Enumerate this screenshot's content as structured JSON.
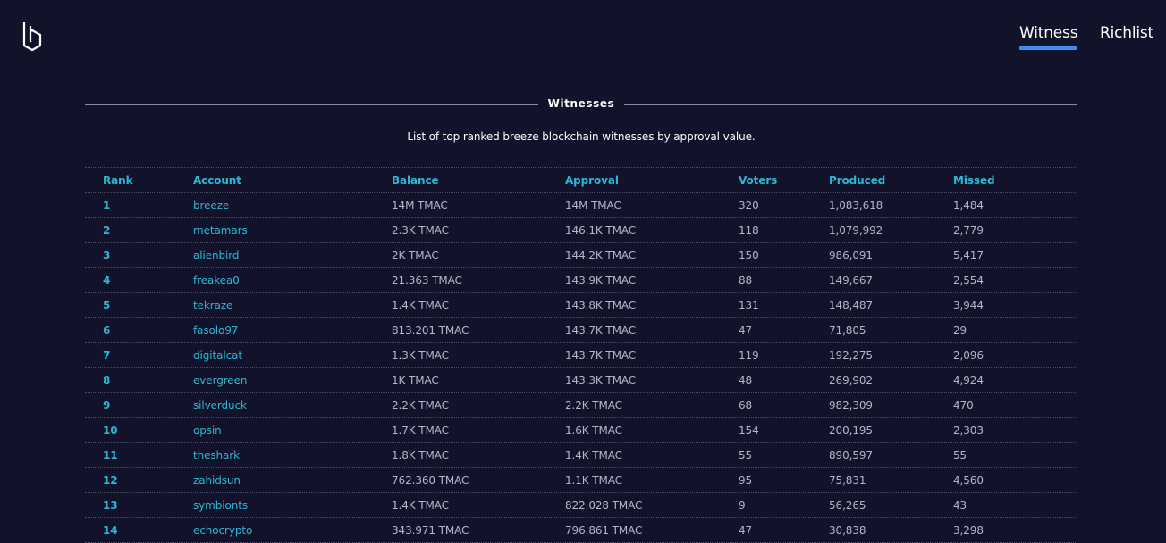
{
  "nav": {
    "tabs": [
      {
        "label": "Witness",
        "active": true
      },
      {
        "label": "Richlist",
        "active": false
      }
    ]
  },
  "brand": {
    "logo_icon": "breeze-logo-icon",
    "accent": "#3d8cf0",
    "link_color": "#2bb6d2"
  },
  "section": {
    "title": "Witnesses",
    "subtitle": "List of top ranked breeze blockchain witnesses by approval value."
  },
  "table": {
    "headers": {
      "rank": "Rank",
      "account": "Account",
      "balance": "Balance",
      "approval": "Approval",
      "voters": "Voters",
      "produced": "Produced",
      "missed": "Missed"
    },
    "rows": [
      {
        "rank": "1",
        "account": "breeze",
        "balance": "14M TMAC",
        "approval": "14M TMAC",
        "voters": "320",
        "produced": "1,083,618",
        "missed": "1,484"
      },
      {
        "rank": "2",
        "account": "metamars",
        "balance": "2.3K TMAC",
        "approval": "146.1K TMAC",
        "voters": "118",
        "produced": "1,079,992",
        "missed": "2,779"
      },
      {
        "rank": "3",
        "account": "alienbird",
        "balance": "2K TMAC",
        "approval": "144.2K TMAC",
        "voters": "150",
        "produced": "986,091",
        "missed": "5,417"
      },
      {
        "rank": "4",
        "account": "freakea0",
        "balance": "21.363 TMAC",
        "approval": "143.9K TMAC",
        "voters": "88",
        "produced": "149,667",
        "missed": "2,554"
      },
      {
        "rank": "5",
        "account": "tekraze",
        "balance": "1.4K TMAC",
        "approval": "143.8K TMAC",
        "voters": "131",
        "produced": "148,487",
        "missed": "3,944"
      },
      {
        "rank": "6",
        "account": "fasolo97",
        "balance": "813.201 TMAC",
        "approval": "143.7K TMAC",
        "voters": "47",
        "produced": "71,805",
        "missed": "29"
      },
      {
        "rank": "7",
        "account": "digitalcat",
        "balance": "1.3K TMAC",
        "approval": "143.7K TMAC",
        "voters": "119",
        "produced": "192,275",
        "missed": "2,096"
      },
      {
        "rank": "8",
        "account": "evergreen",
        "balance": "1K TMAC",
        "approval": "143.3K TMAC",
        "voters": "48",
        "produced": "269,902",
        "missed": "4,924"
      },
      {
        "rank": "9",
        "account": "silverduck",
        "balance": "2.2K TMAC",
        "approval": "2.2K TMAC",
        "voters": "68",
        "produced": "982,309",
        "missed": "470"
      },
      {
        "rank": "10",
        "account": "opsin",
        "balance": "1.7K TMAC",
        "approval": "1.6K TMAC",
        "voters": "154",
        "produced": "200,195",
        "missed": "2,303"
      },
      {
        "rank": "11",
        "account": "theshark",
        "balance": "1.8K TMAC",
        "approval": "1.4K TMAC",
        "voters": "55",
        "produced": "890,597",
        "missed": "55"
      },
      {
        "rank": "12",
        "account": "zahidsun",
        "balance": "762.360 TMAC",
        "approval": "1.1K TMAC",
        "voters": "95",
        "produced": "75,831",
        "missed": "4,560"
      },
      {
        "rank": "13",
        "account": "symbionts",
        "balance": "1.4K TMAC",
        "approval": "822.028 TMAC",
        "voters": "9",
        "produced": "56,265",
        "missed": "43"
      },
      {
        "rank": "14",
        "account": "echocrypto",
        "balance": "343.971 TMAC",
        "approval": "796.861 TMAC",
        "voters": "47",
        "produced": "30,838",
        "missed": "3,298"
      }
    ]
  }
}
